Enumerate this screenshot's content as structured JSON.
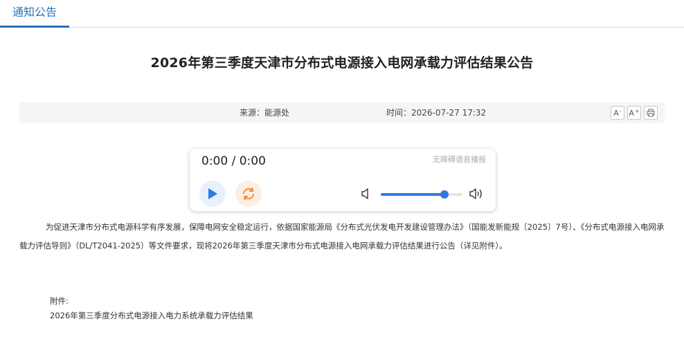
{
  "tabs": {
    "active_label": "通知公告"
  },
  "article": {
    "title": "2026年第三季度天津市分布式电源接入电网承载力评估结果公告",
    "source_label": "来源：",
    "source_value": "能源处",
    "time_label": "时间：",
    "time_value": "2026-07-27 17:32",
    "body": "为促进天津市分布式电源科学有序发展，保障电网安全稳定运行，依据国家能源局《分布式光伏发电开发建设管理办法》（国能发新能规〔2025〕7号）、《分布式电源接入电网承载力评估导则》（DL/T2041-2025）等文件要求，现将2026年第三季度天津市分布式电源接入电网承载力评估结果进行公告（详见附件）。",
    "attachment_label": "附件:",
    "attachment_name": "2026年第三季度分布式电源接入电力系统承载力评估结果"
  },
  "tools": {
    "font_decrease": "A",
    "font_increase": "A",
    "decrease_sup": "-",
    "increase_sup": "+",
    "print_icon": "printer-icon"
  },
  "player": {
    "timecode": "0:00 / 0:00",
    "accessibility_label": "无障碍语音播报",
    "volume_level": 0.78,
    "accent_color": "#2d7be5",
    "loop_color": "#f08a3e"
  }
}
